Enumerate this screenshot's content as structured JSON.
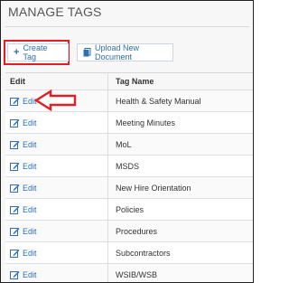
{
  "page": {
    "title": "MANAGE TAGS"
  },
  "toolbar": {
    "create_label": "Create Tag",
    "upload_label": "Upload New Document"
  },
  "table": {
    "columns": [
      "Edit",
      "Tag Name"
    ],
    "edit_label": "Edit",
    "rows": [
      "Health & Safety Manual",
      "Meeting Minutes",
      "MoL",
      "MSDS",
      "New Hire Orientation",
      "Policies",
      "Procedures",
      "Subcontractors",
      "WSIB/WSB"
    ]
  },
  "colors": {
    "accent": "#2c6fb2",
    "annotation": "#e01e26"
  },
  "icons": [
    "plus-icon",
    "document-icon",
    "edit-icon",
    "annotation-arrow"
  ]
}
